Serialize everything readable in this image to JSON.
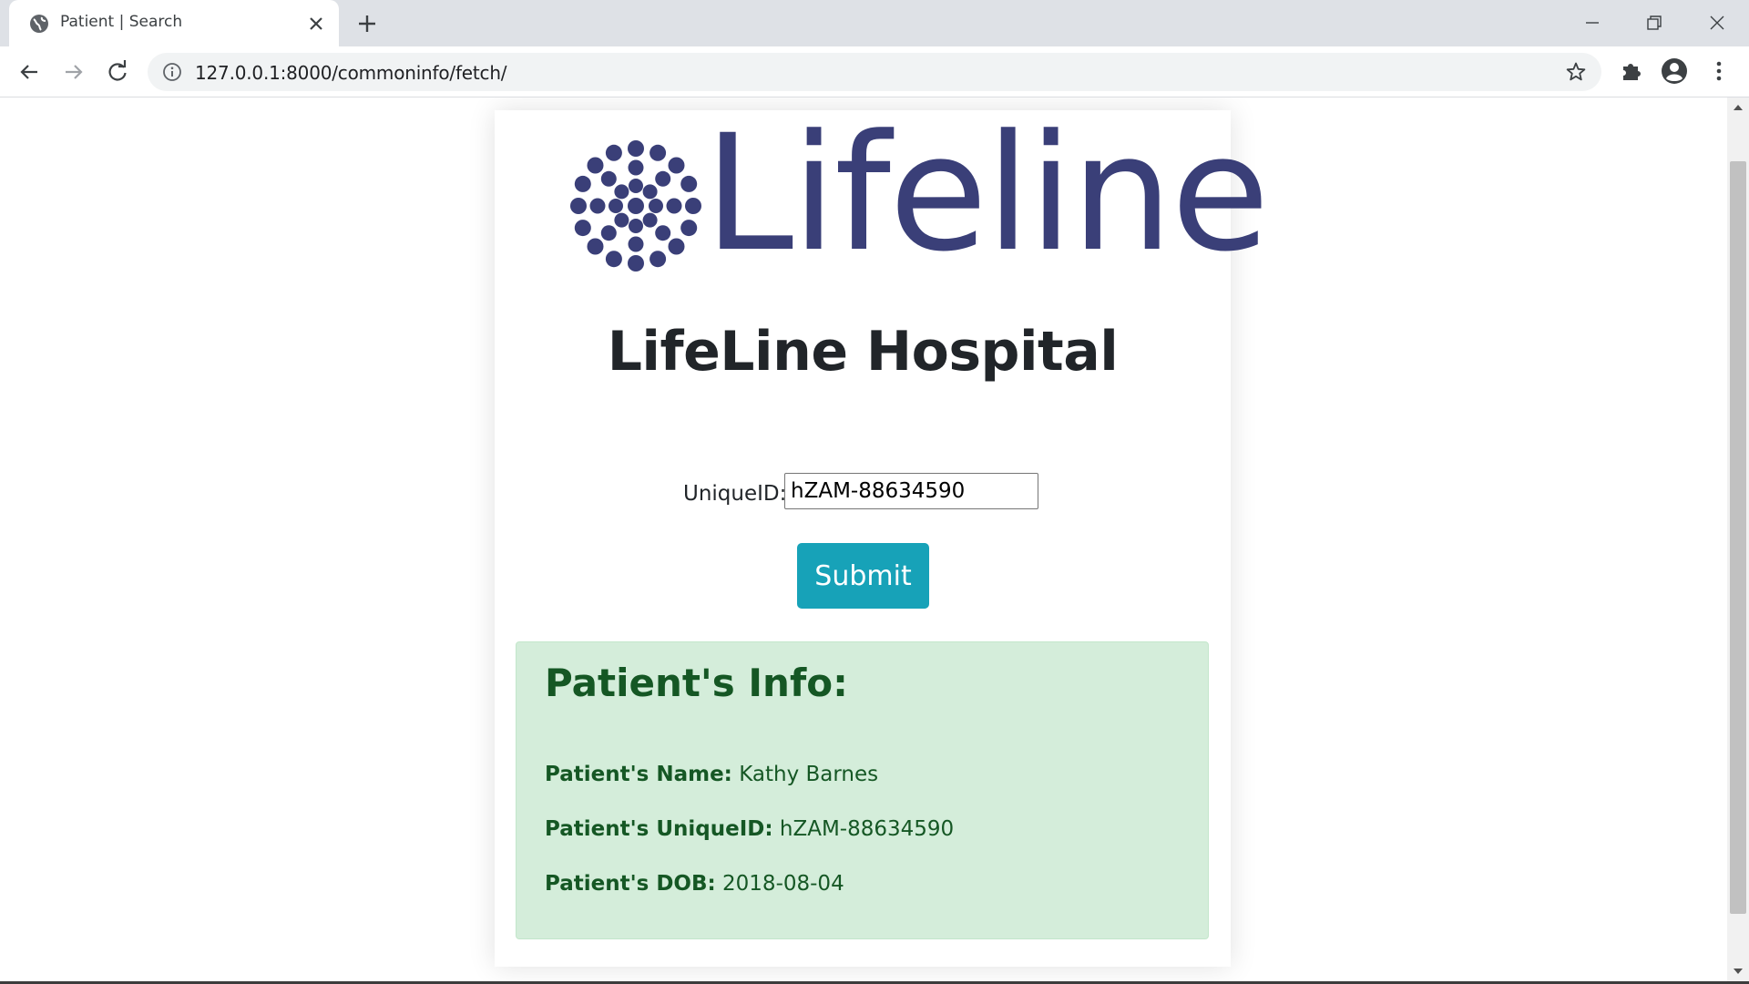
{
  "browser": {
    "tab_title": "Patient | Search",
    "url": "127.0.0.1:8000/commoninfo/fetch/"
  },
  "page": {
    "logo_text": "Lifeline",
    "hospital_name": "LifeLine Hospital",
    "form": {
      "label": "UniqueID:",
      "input_value": "hZAM-88634590",
      "submit_label": "Submit"
    },
    "info": {
      "heading": "Patient's Info:",
      "name_label": "Patient's Name:",
      "name_value": "Kathy Barnes",
      "uid_label": "Patient's UniqueID:",
      "uid_value": "hZAM-88634590",
      "dob_label": "Patient's DOB:",
      "dob_value": "2018-08-04"
    }
  },
  "colors": {
    "brand": "#3a3f78",
    "submit": "#17a2b8",
    "alert_bg": "#d4edda",
    "alert_text": "#155724"
  },
  "icons": {
    "tab_favicon": "globe-icon",
    "tab_close": "close-icon",
    "new_tab": "plus-icon",
    "back": "arrow-left-icon",
    "forward": "arrow-right-icon",
    "reload": "reload-icon",
    "site_info": "info-icon",
    "bookmark": "star-icon",
    "extensions": "puzzle-icon",
    "profile": "account-icon",
    "menu": "kebab-menu-icon"
  }
}
